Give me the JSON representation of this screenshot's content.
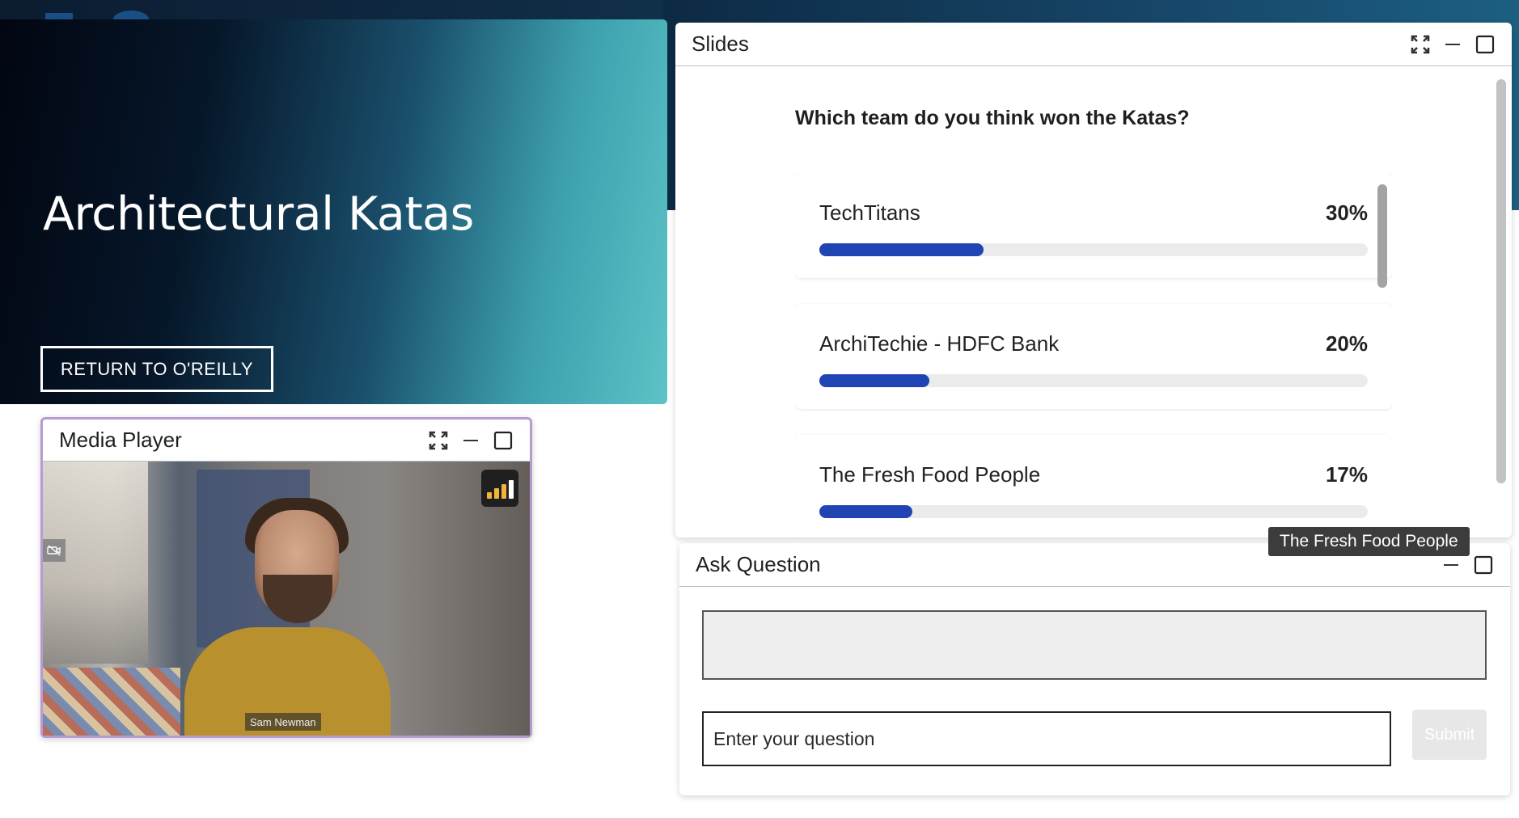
{
  "hero": {
    "title": "Architectural Katas",
    "button_label": "RETURN TO O'REILLY"
  },
  "slides": {
    "title": "Slides",
    "question": "Which team do you think won the Katas?",
    "options": [
      {
        "label": "TechTitans",
        "percent_text": "30%",
        "percent": 30
      },
      {
        "label": "ArchiTechie - HDFC Bank",
        "percent_text": "20%",
        "percent": 20
      },
      {
        "label": "The Fresh Food People",
        "percent_text": "17%",
        "percent": 17
      }
    ],
    "bar_color": "#2044b4"
  },
  "tooltip": {
    "text": "The Fresh Food People"
  },
  "ask_question": {
    "title": "Ask Question",
    "input_placeholder": "Enter your question",
    "submit_label": "Submit"
  },
  "media_player": {
    "title": "Media Player",
    "speaker_name": "Sam Newman",
    "signal_color": "#f0b43c"
  },
  "icons": {
    "expand": "expand-icon",
    "minimize": "minimize-icon",
    "maximize": "maximize-icon",
    "signal": "signal-strength-icon",
    "camera_off": "camera-off-icon"
  }
}
